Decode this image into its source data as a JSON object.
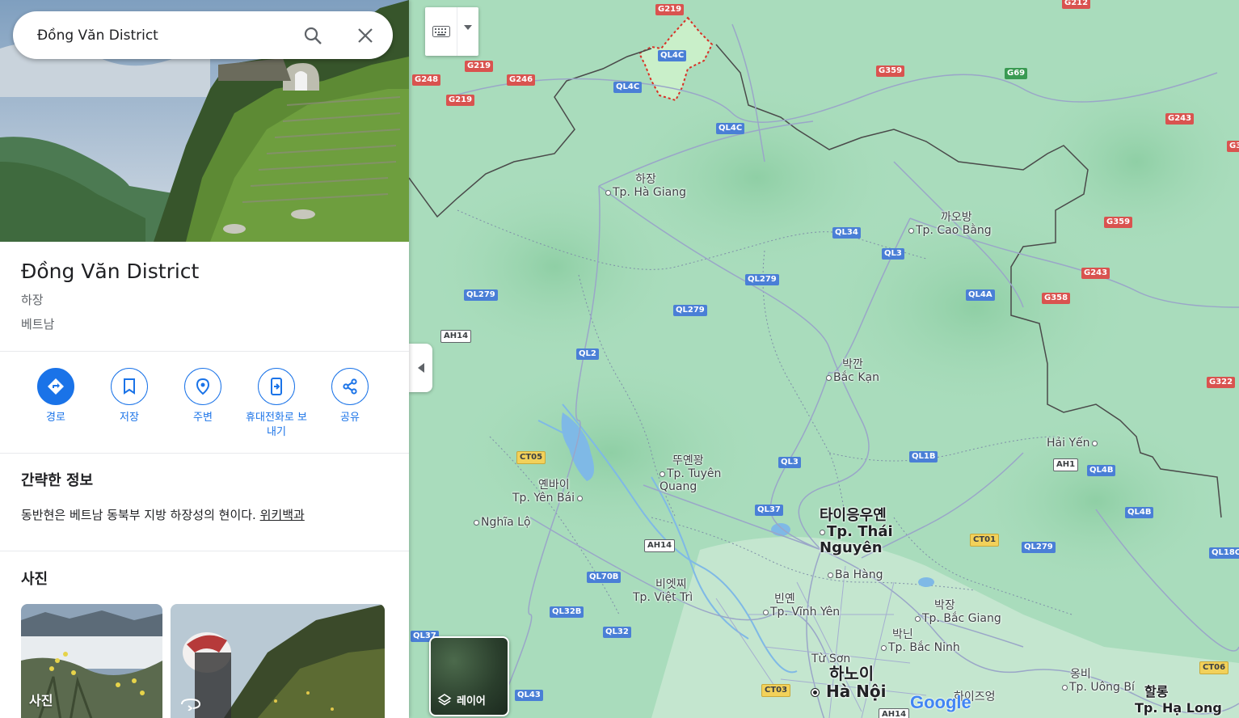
{
  "search": {
    "value": "Đồng Văn District"
  },
  "place": {
    "title": "Đồng Văn District",
    "region": "하장",
    "country": "베트남"
  },
  "actions": [
    {
      "label": "경로",
      "icon": "directions-icon"
    },
    {
      "label": "저장",
      "icon": "bookmark-icon"
    },
    {
      "label": "주변",
      "icon": "nearby-icon"
    },
    {
      "label": "휴대전화로 보\n내기",
      "icon": "send-to-phone-icon"
    },
    {
      "label": "공유",
      "icon": "share-icon"
    }
  ],
  "about": {
    "heading": "간략한 정보",
    "text": "동반현은 베트남 동북부 지방 하장성의 현이다.",
    "link": "위키백과"
  },
  "photos": {
    "heading": "사진",
    "items": [
      {
        "label": "사진"
      },
      {
        "label": ""
      }
    ]
  },
  "map": {
    "layer_label": "레이어",
    "logo": "Google",
    "places": [
      {
        "ko": "하장",
        "vi": "Tp. Hà Giang"
      },
      {
        "ko": "까오방",
        "vi": "Tp. Cao Bằng"
      },
      {
        "ko": "박깐",
        "vi": "Bắc Kạn"
      },
      {
        "ko": "뚜옌꽝",
        "vi": "Tp. Tuyên Quang"
      },
      {
        "ko": "옌바이",
        "vi": "Tp. Yên Bái"
      },
      {
        "ko": "",
        "vi": "Nghĩa Lộ"
      },
      {
        "ko": "타이응우옌",
        "vi": "Tp. Thái Nguyên"
      },
      {
        "ko": "",
        "vi": "Ba Hàng"
      },
      {
        "ko": "비엣찌",
        "vi": "Tp. Việt Trì"
      },
      {
        "ko": "빈옌",
        "vi": "Tp. Vĩnh Yên"
      },
      {
        "ko": "박장",
        "vi": "Tp. Bắc Giang"
      },
      {
        "ko": "박닌",
        "vi": "Tp. Bắc Ninh"
      },
      {
        "ko": "",
        "vi": "Từ Sơn"
      },
      {
        "ko": "하노이",
        "vi": "Hà Nội"
      },
      {
        "ko": "",
        "vi": "Hải Yến"
      },
      {
        "ko": "옹비",
        "vi": "Tp. Uông Bí"
      },
      {
        "ko": "할롱",
        "vi": "Tp. Hạ Long"
      },
      {
        "ko": "하이즈엉",
        "vi": "Hải Dương"
      }
    ],
    "roads": [
      "G219",
      "G219",
      "G219",
      "G248",
      "G246",
      "G212",
      "G359",
      "G69",
      "G243",
      "G359",
      "G243",
      "G358",
      "G322",
      "QL4C",
      "QL4C",
      "QL4C",
      "QL34",
      "QL3",
      "QL279",
      "QL279",
      "QL279",
      "QL4A",
      "AH14",
      "QL2",
      "CT05",
      "QL3",
      "QL1B",
      "AH1",
      "QL4B",
      "QL4B",
      "QL37",
      "AH14",
      "CT01",
      "QL279",
      "QL70B",
      "QL32B",
      "QL32",
      "QL37",
      "QL43",
      "CT03",
      "AH14",
      "CT06",
      "QL18C",
      "G3"
    ]
  }
}
